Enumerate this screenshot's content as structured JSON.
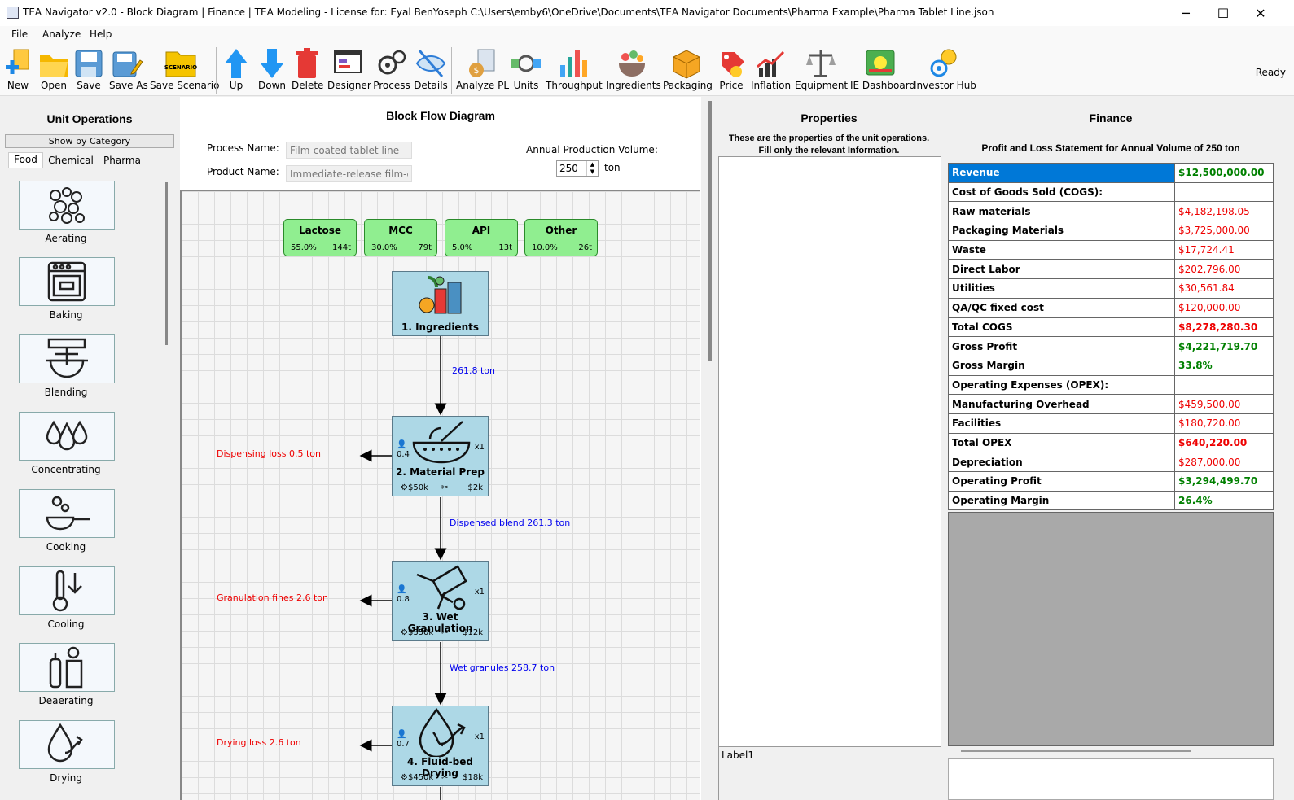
{
  "window": {
    "title": "TEA Navigator v2.0 - Block Diagram | Finance | TEA Modeling - License for: Eyal BenYoseph  C:\\Users\\emby6\\OneDrive\\Documents\\TEA Navigator Documents\\Pharma Example\\Pharma Tablet Line.json",
    "minimize": "─",
    "maximize": "☐",
    "close": "✕"
  },
  "menu": [
    "File",
    "Analyze",
    "Help"
  ],
  "toolbar": {
    "items": [
      {
        "label": "New",
        "icon": "new-icon"
      },
      {
        "label": "Open",
        "icon": "open-folder-icon"
      },
      {
        "label": "Save",
        "icon": "save-disk-icon"
      },
      {
        "label": "Save As",
        "icon": "save-as-icon"
      },
      {
        "label": "Save Scenario",
        "icon": "scenario-folder-icon",
        "badge": "SCENARIO"
      },
      {
        "label": "Up",
        "icon": "arrow-up-icon"
      },
      {
        "label": "Down",
        "icon": "arrow-down-icon"
      },
      {
        "label": "Delete",
        "icon": "trash-icon"
      },
      {
        "label": "Designer",
        "icon": "designer-icon"
      },
      {
        "label": "Process",
        "icon": "process-gear-icon"
      },
      {
        "label": "Details",
        "icon": "eye-hidden-icon"
      },
      {
        "label": "Analyze PL",
        "icon": "analyze-pl-icon"
      },
      {
        "label": "Units",
        "icon": "units-icon"
      },
      {
        "label": "Throughput",
        "icon": "throughput-chart-icon"
      },
      {
        "label": "Ingredients",
        "icon": "ingredients-bowl-icon"
      },
      {
        "label": "Packaging",
        "icon": "package-box-icon"
      },
      {
        "label": "Price",
        "icon": "price-tag-icon"
      },
      {
        "label": "Inflation",
        "icon": "inflation-chart-icon"
      },
      {
        "label": "Equipment",
        "icon": "equipment-scale-icon"
      },
      {
        "label": "IE Dashboard",
        "icon": "dashboard-icon"
      },
      {
        "label": "Investor Hub",
        "icon": "investor-hub-icon"
      }
    ],
    "status": "Ready"
  },
  "left": {
    "title": "Unit Operations",
    "show_by": "Show by Category",
    "tabs": [
      "Food",
      "Chemical",
      "Pharma"
    ],
    "items": [
      {
        "label": "Aerating",
        "icon": "aerating-icon"
      },
      {
        "label": "Baking",
        "icon": "oven-icon"
      },
      {
        "label": "Blending",
        "icon": "mixer-icon"
      },
      {
        "label": "Concentrating",
        "icon": "drops-icon"
      },
      {
        "label": "Cooking",
        "icon": "pan-icon"
      },
      {
        "label": "Cooling",
        "icon": "thermometer-icon"
      },
      {
        "label": "Deaerating",
        "icon": "deaerator-icon"
      },
      {
        "label": "Drying",
        "icon": "drying-icon"
      }
    ]
  },
  "diagram": {
    "title": "Block Flow Diagram",
    "process_label": "Process Name:",
    "process_value": "Film-coated tablet line",
    "product_label": "Product Name:",
    "product_value": "Immediate-release film-coat",
    "volume_label": "Annual Production Volume:",
    "volume_value": "250",
    "volume_unit": "ton",
    "ingredients": [
      {
        "name": "Lactose",
        "pct": "55.0%",
        "mass": "144t"
      },
      {
        "name": "MCC",
        "pct": "30.0%",
        "mass": "79t"
      },
      {
        "name": "API",
        "pct": "5.0%",
        "mass": "13t"
      },
      {
        "name": "Other",
        "pct": "10.0%",
        "mass": "26t"
      }
    ],
    "blocks": [
      {
        "title": "1. Ingredients",
        "icon": "ingredients-icon"
      },
      {
        "title": "2. Material Prep",
        "icon": "mortar-pestle-icon",
        "people": "0.4",
        "mult": "x1",
        "capex": "$50k",
        "opex": "$2k"
      },
      {
        "title": "3. Wet Granulation",
        "icon": "granulator-icon",
        "people": "0.8",
        "mult": "x1",
        "capex": "$350k",
        "opex": "$12k"
      },
      {
        "title": "4. Fluid-bed Drying",
        "icon": "drying-icon",
        "people": "0.7",
        "mult": "x1",
        "capex": "$450k",
        "opex": "$18k"
      }
    ],
    "flows": [
      "261.8 ton",
      "Dispensed blend 261.3 ton",
      "Wet granules 258.7 ton"
    ],
    "losses": [
      "Dispensing loss 0.5 ton",
      "Granulation fines 2.6 ton",
      "Drying loss 2.6 ton"
    ]
  },
  "properties": {
    "title": "Properties",
    "desc1": "These are the properties of the unit operations.",
    "desc2": "Fill only the relevant Information.",
    "label": "Label1"
  },
  "finance": {
    "title": "Finance",
    "subtitle": "Profit and Loss Statement for Annual Volume of 250 ton",
    "rows": [
      {
        "label": "Revenue",
        "value": "$12,500,000.00",
        "style": "grn",
        "selected": true
      },
      {
        "label": "Cost of Goods Sold (COGS):",
        "value": "",
        "style": ""
      },
      {
        "label": "Raw materials",
        "value": "$4,182,198.05",
        "style": "red"
      },
      {
        "label": "Packaging Materials",
        "value": "$3,725,000.00",
        "style": "red"
      },
      {
        "label": "Waste",
        "value": "$17,724.41",
        "style": "red"
      },
      {
        "label": "Direct Labor",
        "value": "$202,796.00",
        "style": "red"
      },
      {
        "label": "Utilities",
        "value": "$30,561.84",
        "style": "red"
      },
      {
        "label": "QA/QC fixed cost",
        "value": "$120,000.00",
        "style": "red"
      },
      {
        "label": "Total COGS",
        "value": "$8,278,280.30",
        "style": "redb"
      },
      {
        "label": "Gross Profit",
        "value": "$4,221,719.70",
        "style": "grn"
      },
      {
        "label": "Gross Margin",
        "value": "33.8%",
        "style": "grn"
      },
      {
        "label": "Operating Expenses (OPEX):",
        "value": "",
        "style": ""
      },
      {
        "label": "Manufacturing Overhead",
        "value": "$459,500.00",
        "style": "red"
      },
      {
        "label": "Facilities",
        "value": "$180,720.00",
        "style": "red"
      },
      {
        "label": "Total OPEX",
        "value": "$640,220.00",
        "style": "redb"
      },
      {
        "label": "Depreciation",
        "value": "$287,000.00",
        "style": "red"
      },
      {
        "label": "Operating Profit",
        "value": "$3,294,499.70",
        "style": "grn"
      },
      {
        "label": "Operating Margin",
        "value": "26.4%",
        "style": "grn"
      }
    ]
  }
}
